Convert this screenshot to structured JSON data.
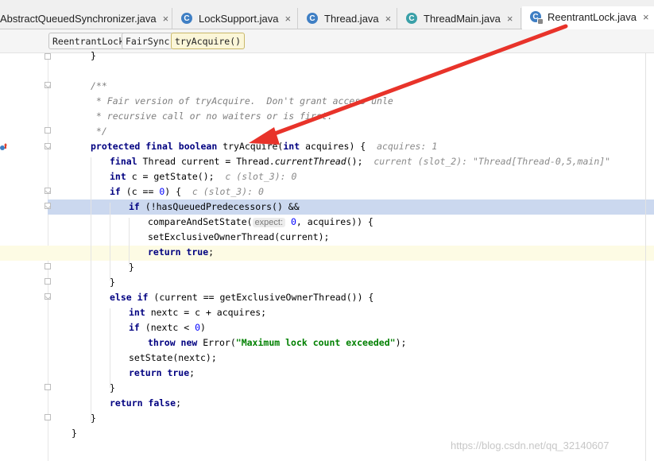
{
  "tabs": [
    {
      "label": "AbstractQueuedSynchronizer.java",
      "active": false,
      "icon": "none"
    },
    {
      "label": "LockSupport.java",
      "active": false,
      "icon": "class-icon"
    },
    {
      "label": "Thread.java",
      "active": false,
      "icon": "class-icon"
    },
    {
      "label": "ThreadMain.java",
      "active": false,
      "icon": "runnable-class-icon"
    },
    {
      "label": "ReentrantLock.java",
      "active": true,
      "icon": "class-icon"
    }
  ],
  "tab_close_glyph": "×",
  "breadcrumb": [
    "ReentrantLock",
    "FairSync",
    "tryAcquire()"
  ],
  "code": {
    "l1": "}",
    "l2": "/**",
    "l3": " * Fair version of tryAcquire.  Don't grant access unle",
    "l4": " * recursive call or no waiters or is first.",
    "l5": " */",
    "l6_kw": "protected final boolean",
    "l6_name": "tryAcquire(",
    "l6_kw2": "int",
    "l6_rest": " acquires) {",
    "l6_hint": "acquires: 1",
    "l7_kw": "final",
    "l7_a": " Thread current = Thread.",
    "l7_it": "currentThread",
    "l7_b": "();",
    "l7_hint": "current (slot_2): \"Thread[Thread-0,5,main]\"",
    "l8_kw": "int",
    "l8_a": " c = getState();",
    "l8_hint": "c (slot_3): 0",
    "l9_kw": "if",
    "l9_a": " (c == ",
    "l9_num": "0",
    "l9_b": ") {",
    "l9_hint": "c (slot_3): 0",
    "l10_kw": "if",
    "l10_a": " (!hasQueuedPredecessors() &&",
    "l11_a": "compareAndSetState(",
    "l11_param": "expect:",
    "l11_num": "0",
    "l11_b": ", acquires)) {",
    "l12": "setExclusiveOwnerThread(current);",
    "l13_kw": "return true",
    "l13_b": ";",
    "l14": "}",
    "l15": "}",
    "l16_kw": "else if",
    "l16_a": " (current == getExclusiveOwnerThread()) {",
    "l17_kw": "int",
    "l17_a": " nextc = c + acquires;",
    "l18_kw": "if",
    "l18_a": " (nextc < ",
    "l18_num": "0",
    "l18_b": ")",
    "l19_kw": "throw new",
    "l19_a": " Error(",
    "l19_str": "\"Maximum lock count exceeded\"",
    "l19_b": ");",
    "l20": "setState(nextc);",
    "l21_kw": "return true",
    "l21_b": ";",
    "l22": "}",
    "l23_kw": "return false",
    "l23_b": ";",
    "l24": "}",
    "l25": "}"
  },
  "watermark": "https://blog.csdn.net/qq_32140607",
  "colors": {
    "keyword": "#000080",
    "comment": "#808080",
    "string": "#008000",
    "number": "#0000ff",
    "execution_highlight": "#cbd8ef",
    "arrow": "#e8332a"
  }
}
